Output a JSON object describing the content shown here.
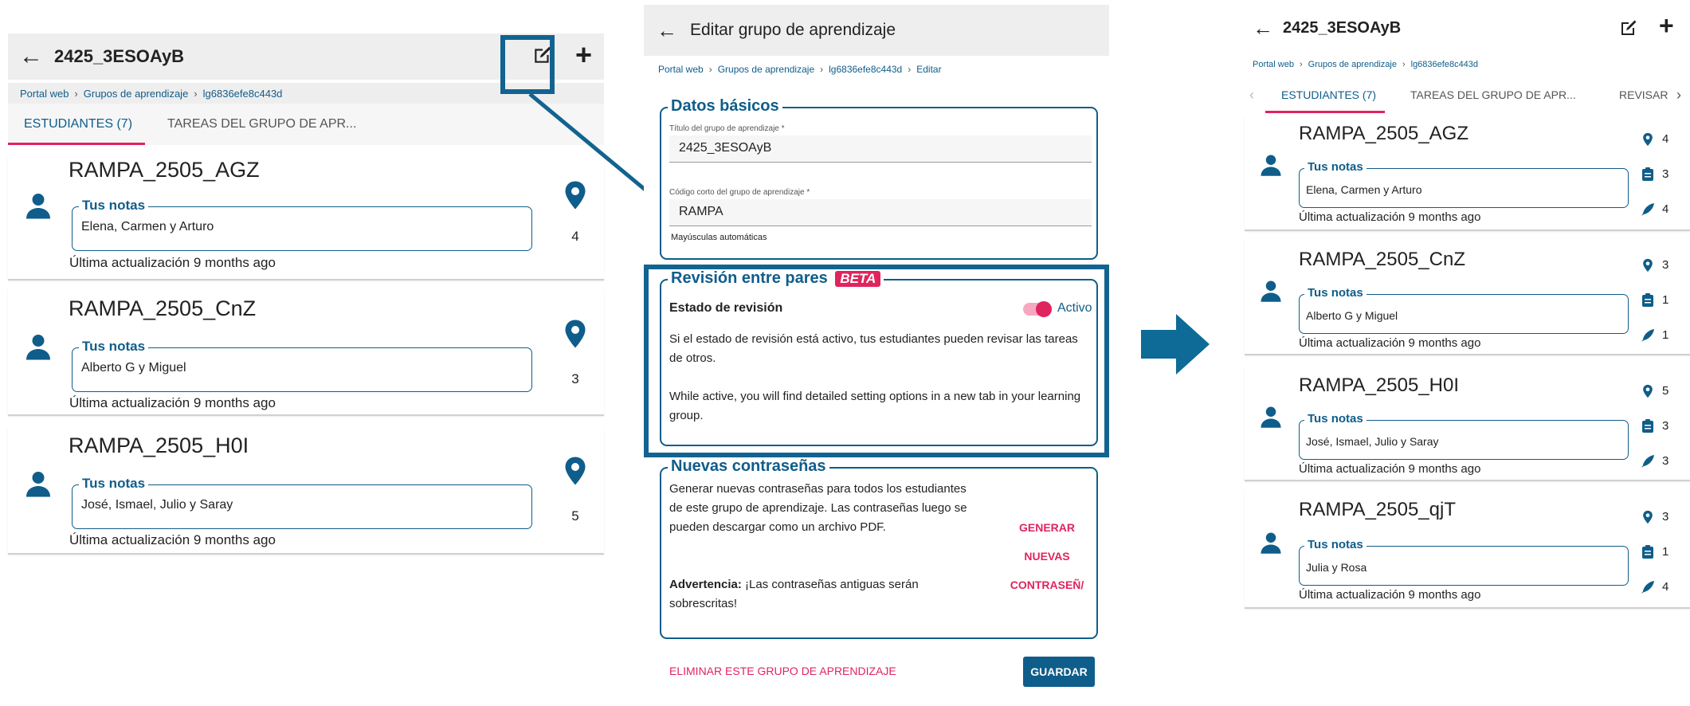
{
  "left": {
    "title": "2425_3ESOAyB",
    "breadcrumb": [
      "Portal web",
      "Grupos de aprendizaje",
      "lg6836efe8c443d"
    ],
    "tabs": [
      {
        "label": "ESTUDIANTES (7)"
      },
      {
        "label": "TAREAS DEL GRUPO DE APR..."
      }
    ],
    "students": [
      {
        "name": "RAMPA_2505_AGZ",
        "notes_label": "Tus notas",
        "notes": "Elena, Carmen y Arturo",
        "updated": "Última actualización 9 months ago",
        "count": "4"
      },
      {
        "name": "RAMPA_2505_CnZ",
        "notes_label": "Tus notas",
        "notes": "Alberto G y Miguel",
        "updated": "Última actualización 9 months ago",
        "count": "3"
      },
      {
        "name": "RAMPA_2505_H0I",
        "notes_label": "Tus notas",
        "notes": "José, Ismael, Julio y Saray",
        "updated": "Última actualización 9 months ago",
        "count": "5"
      }
    ]
  },
  "middle": {
    "title": "Editar grupo de aprendizaje",
    "breadcrumb": [
      "Portal web",
      "Grupos de aprendizaje",
      "lg6836efe8c443d",
      "Editar"
    ],
    "basic": {
      "legend": "Datos básicos",
      "title_label": "Título del grupo de aprendizaje *",
      "title_value": "2425_3ESOAyB",
      "code_label": "Código corto del grupo de aprendizaje *",
      "code_value": "RAMPA",
      "code_hint": "Mayúsculas automáticas"
    },
    "review": {
      "legend": "Revisión entre pares",
      "badge": "BETA",
      "state_label": "Estado de revisión",
      "toggle_label": "Activo",
      "text1": "Si el estado de revisión está activo, tus estudiantes pueden revisar las tareas de otros.",
      "text2": "While active, you will find detailed setting options in a new tab in your learning group."
    },
    "passwords": {
      "legend": "Nuevas contraseñas",
      "text": "Generar nuevas contraseñas para todos los estudiantes de este grupo de aprendizaje. Las contraseñas luego se pueden descargar como un archivo PDF.",
      "warning_bold": "Advertencia:",
      "warning_text": " ¡Las contraseñas antiguas serán sobrescritas!",
      "button": [
        "GENERAR",
        "NUEVAS",
        "CONTRASEÑ/"
      ]
    },
    "delete_label": "ELIMINAR ESTE GRUPO DE APRENDIZAJE",
    "save_label": "GUARDAR"
  },
  "right": {
    "title": "2425_3ESOAyB",
    "breadcrumb": [
      "Portal web",
      "Grupos de aprendizaje",
      "lg6836efe8c443d"
    ],
    "tabs": [
      {
        "label": "ESTUDIANTES (7)"
      },
      {
        "label": "TAREAS DEL GRUPO DE APR..."
      },
      {
        "label": "REVISAR"
      }
    ],
    "students": [
      {
        "name": "RAMPA_2505_AGZ",
        "notes_label": "Tus notas",
        "notes": "Elena, Carmen y Arturo",
        "updated": "Última actualización 9 months ago",
        "c1": "4",
        "c2": "3",
        "c3": "4"
      },
      {
        "name": "RAMPA_2505_CnZ",
        "notes_label": "Tus notas",
        "notes": "Alberto G y Miguel",
        "updated": "Última actualización 9 months ago",
        "c1": "3",
        "c2": "1",
        "c3": "1"
      },
      {
        "name": "RAMPA_2505_H0I",
        "notes_label": "Tus notas",
        "notes": "José, Ismael, Julio y Saray",
        "updated": "Última actualización 9 months ago",
        "c1": "5",
        "c2": "3",
        "c3": "3"
      },
      {
        "name": "RAMPA_2505_qjT",
        "notes_label": "Tus notas",
        "notes": "Julia y Rosa",
        "updated": "Última actualización 9 months ago",
        "c1": "3",
        "c2": "1",
        "c3": "4"
      }
    ]
  },
  "colors": {
    "primary": "#0f5d8a",
    "accent": "#e0245e",
    "highlight": "#12638f",
    "arrow": "#0e6a96"
  },
  "icons": [
    "back-arrow-icon",
    "edit-icon",
    "plus-icon",
    "person-icon",
    "location-pin-icon",
    "clipboard-icon",
    "feather-pen-icon",
    "chevron-left-icon",
    "chevron-right-icon"
  ]
}
